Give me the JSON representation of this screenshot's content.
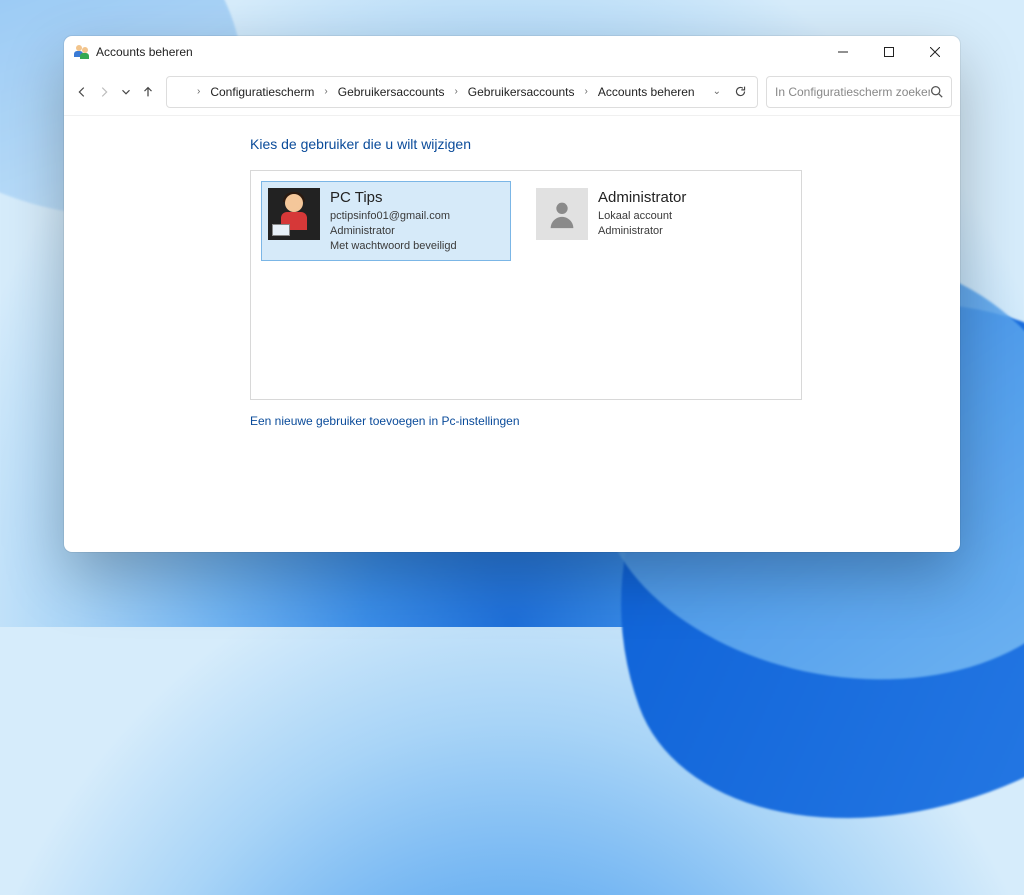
{
  "window": {
    "title": "Accounts beheren"
  },
  "breadcrumb": {
    "items": [
      "Configuratiescherm",
      "Gebruikersaccounts",
      "Gebruikersaccounts",
      "Accounts beheren"
    ]
  },
  "search": {
    "placeholder": "In Configuratiescherm zoeken"
  },
  "heading": "Kies de gebruiker die u wilt wijzigen",
  "accounts": [
    {
      "name": "PC Tips",
      "email": "pctipsinfo01@gmail.com",
      "role": "Administrator",
      "extra": "Met wachtwoord beveiligd",
      "selected": true,
      "avatar": "pctips"
    },
    {
      "name": "Administrator",
      "email": "Lokaal account",
      "role": "Administrator",
      "extra": "",
      "selected": false,
      "avatar": "generic"
    }
  ],
  "add_user_link": "Een nieuwe gebruiker toevoegen in Pc-instellingen"
}
